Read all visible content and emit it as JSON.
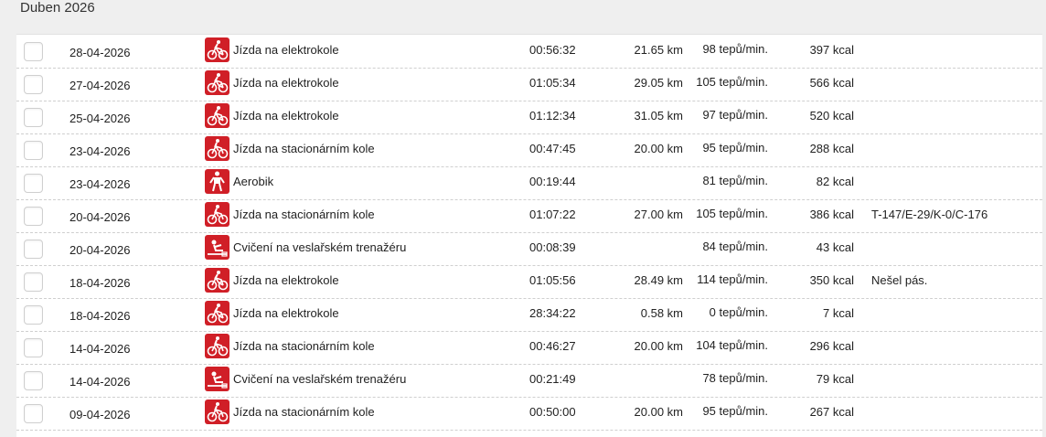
{
  "month_title": "Duben 2026",
  "rows": [
    {
      "date": "28-04-2026",
      "icon": "bike-icon",
      "activity": "Jízda na elektrokole",
      "duration": "00:56:32",
      "distance": "21.65 km",
      "hr": "98 tepů/min.",
      "kcal": "397 kcal",
      "note": ""
    },
    {
      "date": "27-04-2026",
      "icon": "bike-icon",
      "activity": "Jízda na elektrokole",
      "duration": "01:05:34",
      "distance": "29.05 km",
      "hr": "105 tepů/min.",
      "kcal": "566 kcal",
      "note": ""
    },
    {
      "date": "25-04-2026",
      "icon": "bike-icon",
      "activity": "Jízda na elektrokole",
      "duration": "01:12:34",
      "distance": "31.05 km",
      "hr": "97 tepů/min.",
      "kcal": "520 kcal",
      "note": ""
    },
    {
      "date": "23-04-2026",
      "icon": "stationary-bike-icon",
      "activity": "Jízda na stacionárním kole",
      "duration": "00:47:45",
      "distance": "20.00 km",
      "hr": "95 tepů/min.",
      "kcal": "288 kcal",
      "note": ""
    },
    {
      "date": "23-04-2026",
      "icon": "aerobic-icon",
      "activity": "Aerobik",
      "duration": "00:19:44",
      "distance": "",
      "hr": "81 tepů/min.",
      "kcal": "82 kcal",
      "note": ""
    },
    {
      "date": "20-04-2026",
      "icon": "stationary-bike-icon",
      "activity": "Jízda na stacionárním kole",
      "duration": "01:07:22",
      "distance": "27.00 km",
      "hr": "105 tepů/min.",
      "kcal": "386 kcal",
      "note": "T-147/E-29/K-0/C-176"
    },
    {
      "date": "20-04-2026",
      "icon": "rowing-icon",
      "activity": "Cvičení na veslařském trenažéru",
      "duration": "00:08:39",
      "distance": "",
      "hr": "84 tepů/min.",
      "kcal": "43 kcal",
      "note": ""
    },
    {
      "date": "18-04-2026",
      "icon": "bike-icon",
      "activity": "Jízda na elektrokole",
      "duration": "01:05:56",
      "distance": "28.49 km",
      "hr": "114 tepů/min.",
      "kcal": "350 kcal",
      "note": "Nešel pás."
    },
    {
      "date": "18-04-2026",
      "icon": "bike-icon",
      "activity": "Jízda na elektrokole",
      "duration": "28:34:22",
      "distance": "0.58 km",
      "hr": "0 tepů/min.",
      "kcal": "7 kcal",
      "note": ""
    },
    {
      "date": "14-04-2026",
      "icon": "stationary-bike-icon",
      "activity": "Jízda na stacionárním kole",
      "duration": "00:46:27",
      "distance": "20.00 km",
      "hr": "104 tepů/min.",
      "kcal": "296 kcal",
      "note": ""
    },
    {
      "date": "14-04-2026",
      "icon": "rowing-icon",
      "activity": "Cvičení na veslařském trenažéru",
      "duration": "00:21:49",
      "distance": "",
      "hr": "78 tepů/min.",
      "kcal": "79 kcal",
      "note": ""
    },
    {
      "date": "09-04-2026",
      "icon": "stationary-bike-icon",
      "activity": "Jízda na stacionárním kole",
      "duration": "00:50:00",
      "distance": "20.00 km",
      "hr": "95 tepů/min.",
      "kcal": "267 kcal",
      "note": ""
    }
  ]
}
